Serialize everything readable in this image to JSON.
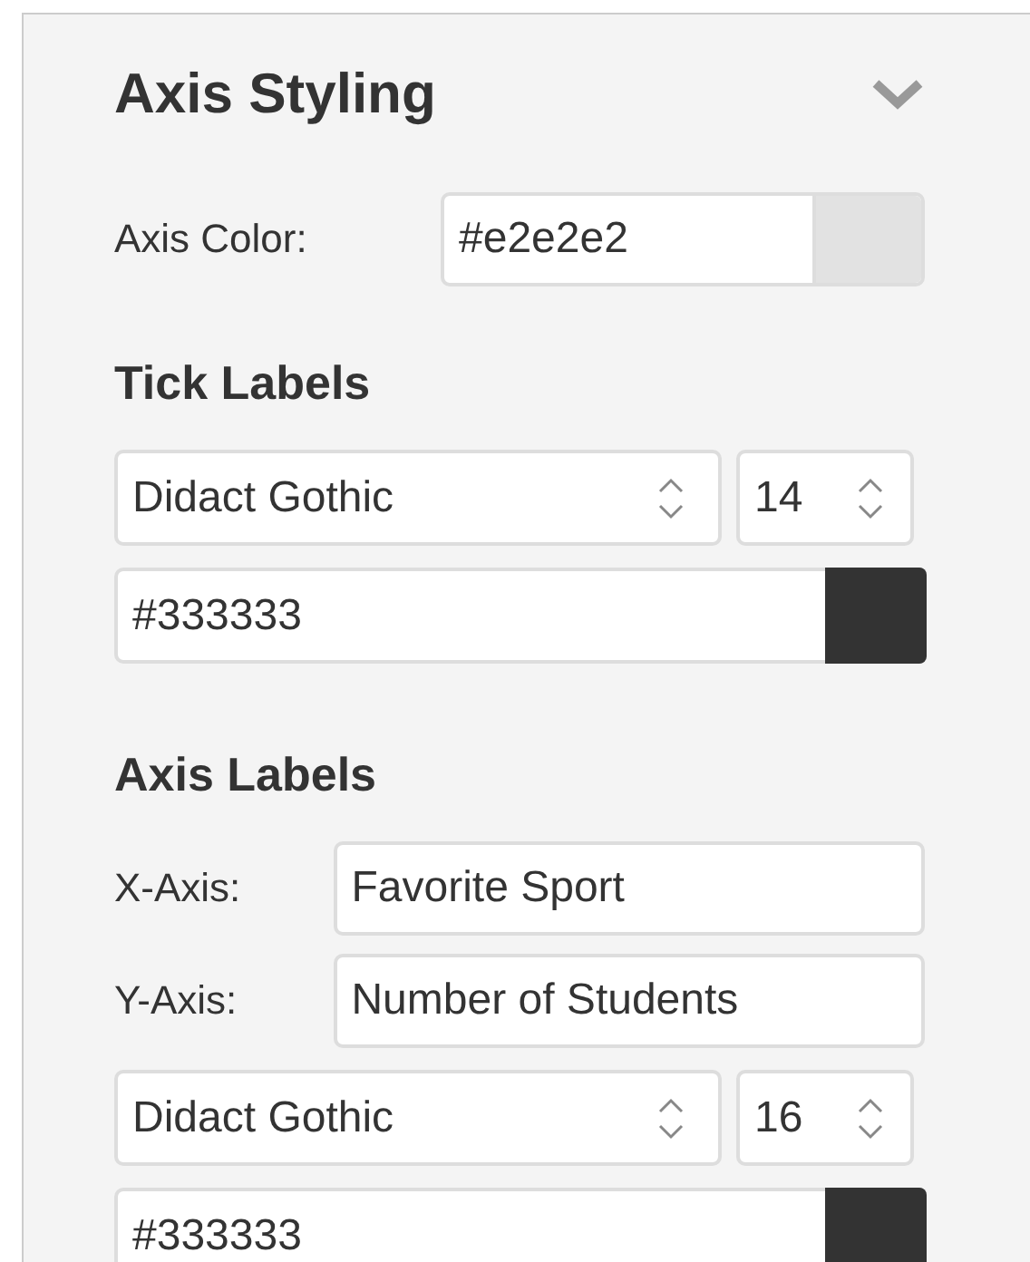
{
  "section": {
    "title": "Axis Styling"
  },
  "axis_color": {
    "label": "Axis Color:",
    "value": "#e2e2e2"
  },
  "tick_labels": {
    "heading": "Tick Labels",
    "font": "Didact Gothic",
    "size": "14",
    "color": "#333333"
  },
  "axis_labels": {
    "heading": "Axis Labels",
    "fields": [
      {
        "label": "X-Axis:",
        "value": "Favorite Sport"
      },
      {
        "label": "Y-Axis:",
        "value": "Number of Students"
      }
    ],
    "font": "Didact Gothic",
    "size": "16",
    "color": "#333333"
  }
}
